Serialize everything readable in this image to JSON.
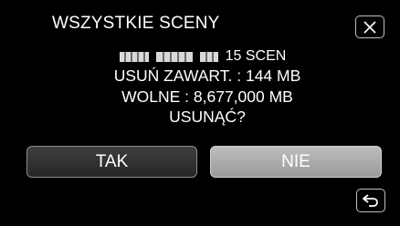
{
  "dialog": {
    "title": "WSZYSTKIE SCENY",
    "scenes_count": "15 SCEN",
    "delete_content": "USUŃ ZAWART. : 144 MB",
    "free_space": "WOLNE : 8,677,000 MB",
    "question": "USUNĄĆ?"
  },
  "buttons": {
    "yes_label": "TAK",
    "no_label": "NIE"
  },
  "icons": {
    "close": "close-icon",
    "back": "back-arrow-icon"
  },
  "colors": {
    "background": "#000000",
    "text": "#ffffff",
    "selected_button": "#a8a8a8",
    "button": "#303030"
  }
}
